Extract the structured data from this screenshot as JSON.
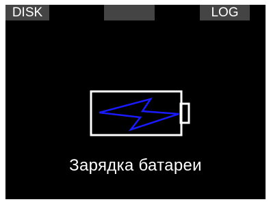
{
  "softkeys": {
    "left_label": "DISK",
    "middle_label": "",
    "right_label": "LOG"
  },
  "battery": {
    "icon": "battery-charging-icon",
    "bolt_icon": "lightning-bolt-icon",
    "outline_color": "#ffffff",
    "bolt_color": "#1a1aff"
  },
  "status": {
    "text": "Зарядка батареи"
  },
  "colors": {
    "background": "#000000",
    "softkey_background": "#444444",
    "text": "#ffffff"
  }
}
